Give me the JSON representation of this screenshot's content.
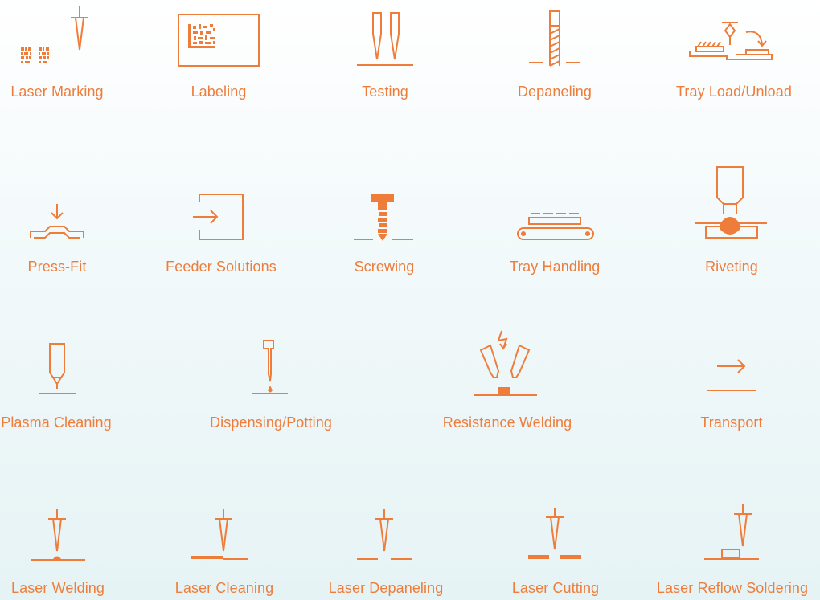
{
  "accent_color": "#ee7d3b",
  "items": [
    {
      "label": "Laser Marking",
      "icon": "laser-marking-icon"
    },
    {
      "label": "Labeling",
      "icon": "labeling-icon"
    },
    {
      "label": "Testing",
      "icon": "testing-icon"
    },
    {
      "label": "Depaneling",
      "icon": "depaneling-icon"
    },
    {
      "label": "Tray Load/Unload",
      "icon": "tray-load-unload-icon"
    },
    {
      "label": "Press-Fit",
      "icon": "press-fit-icon"
    },
    {
      "label": "Feeder Solutions",
      "icon": "feeder-solutions-icon"
    },
    {
      "label": "Screwing",
      "icon": "screwing-icon"
    },
    {
      "label": "Tray Handling",
      "icon": "tray-handling-icon"
    },
    {
      "label": "Riveting",
      "icon": "riveting-icon"
    },
    {
      "label": "Plasma Cleaning",
      "icon": "plasma-cleaning-icon"
    },
    {
      "label": "Dispensing/Potting",
      "icon": "dispensing-potting-icon"
    },
    {
      "label": "Resistance Welding",
      "icon": "resistance-welding-icon"
    },
    {
      "label": "Transport",
      "icon": "transport-icon"
    },
    {
      "label": "Laser Welding",
      "icon": "laser-welding-icon"
    },
    {
      "label": "Laser Cleaning",
      "icon": "laser-cleaning-icon"
    },
    {
      "label": "Laser Depaneling",
      "icon": "laser-depaneling-icon"
    },
    {
      "label": "Laser Cutting",
      "icon": "laser-cutting-icon"
    },
    {
      "label": "Laser Reflow Soldering",
      "icon": "laser-reflow-soldering-icon"
    }
  ]
}
